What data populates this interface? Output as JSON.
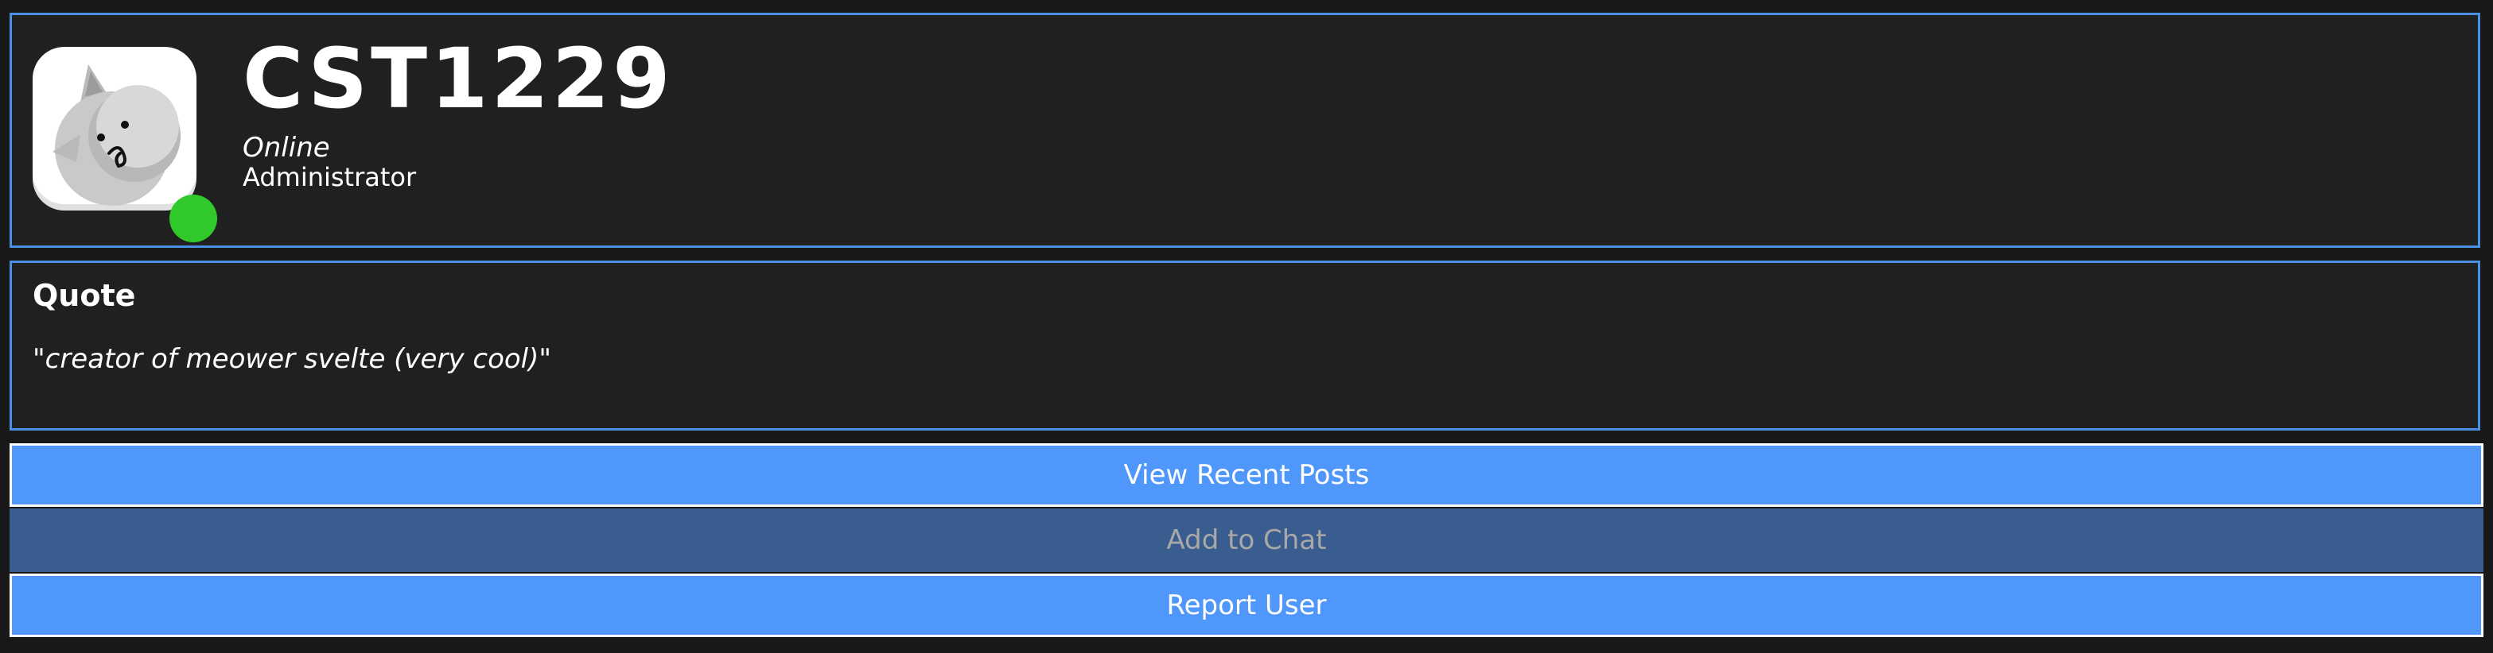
{
  "profile": {
    "username": "CST1229",
    "status": "Online",
    "role": "Administrator",
    "avatar_icon": "cat-avatar-icon",
    "status_color": "#31c92a"
  },
  "quote": {
    "title": "Quote",
    "text": "\"creator of meower svelte (very cool)\""
  },
  "actions": {
    "view_recent_posts": "View Recent Posts",
    "add_to_chat": "Add to Chat",
    "report_user": "Report User"
  },
  "colors": {
    "accent": "#4a90e2",
    "button": "#4f97fb",
    "button_disabled": "#3a5d8f",
    "panel_bg": "#202020",
    "page_bg": "#181818"
  }
}
